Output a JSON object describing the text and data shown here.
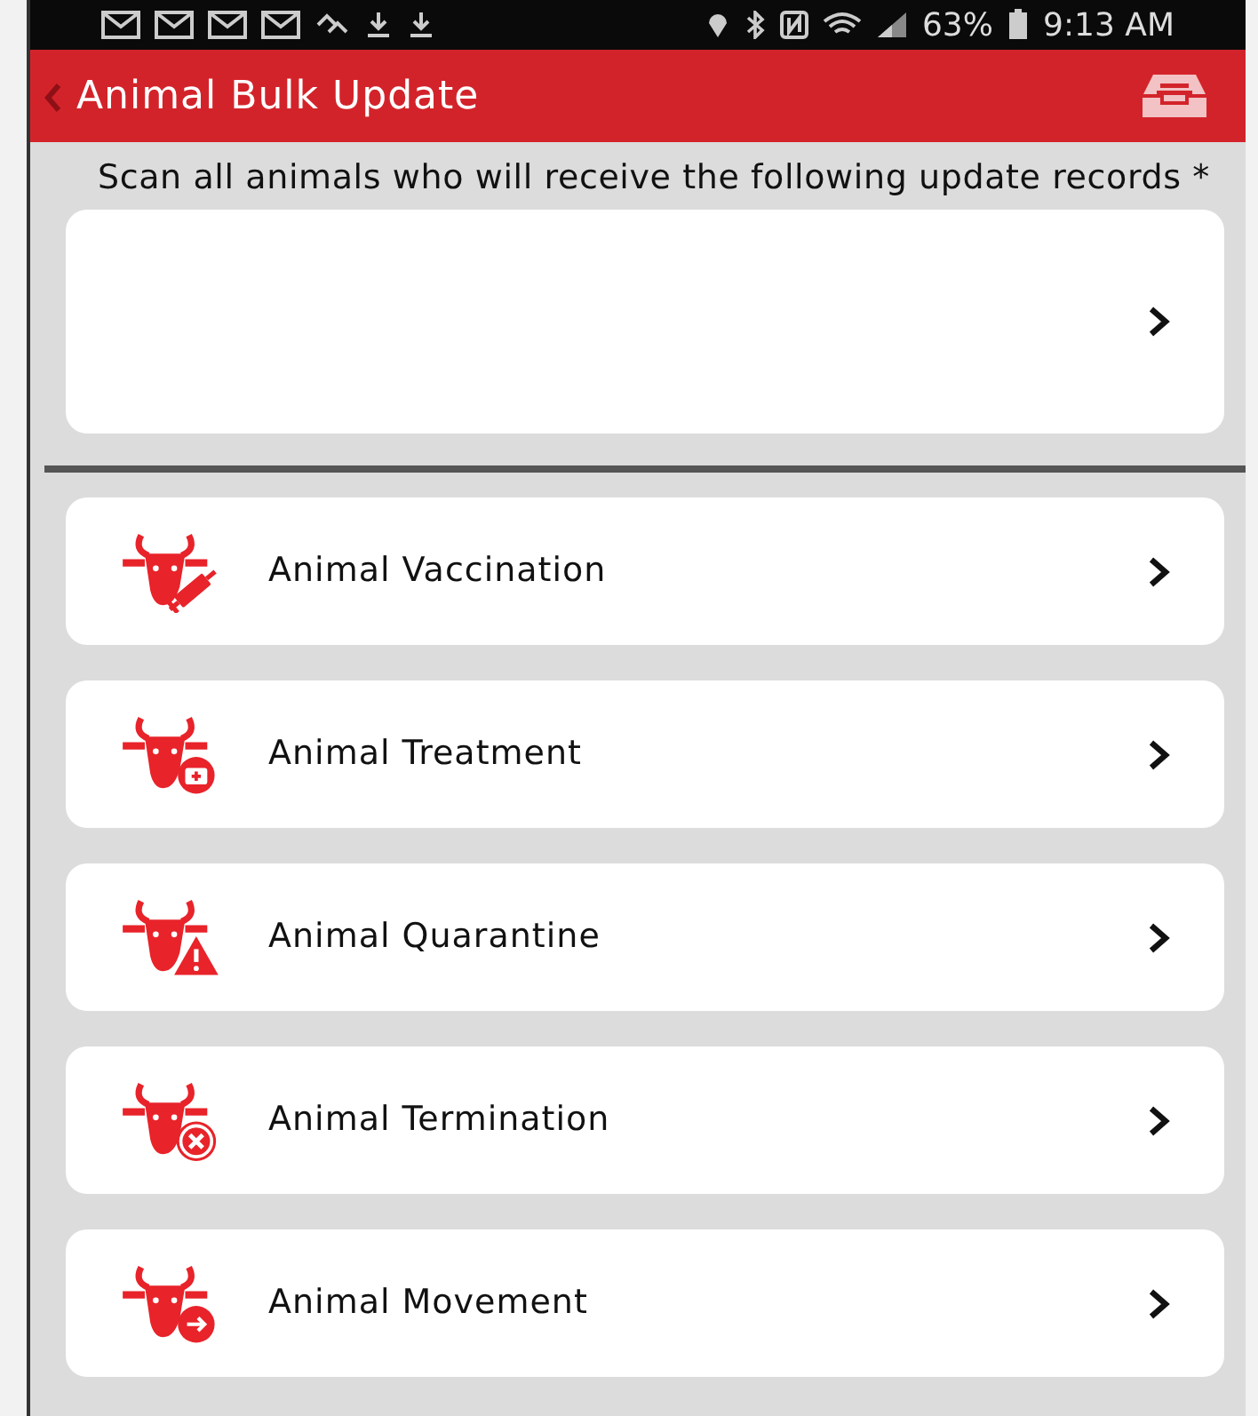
{
  "status_bar": {
    "battery": "63%",
    "time": "9:13 AM"
  },
  "header": {
    "title": "Animal Bulk Update"
  },
  "scan": {
    "label": "Scan all animals who will receive the following update records *"
  },
  "records": [
    {
      "kind": "vaccination",
      "label": "Animal Vaccination"
    },
    {
      "kind": "treatment",
      "label": "Animal Treatment"
    },
    {
      "kind": "quarantine",
      "label": "Animal Quarantine"
    },
    {
      "kind": "termination",
      "label": "Animal Termination"
    },
    {
      "kind": "movement",
      "label": "Animal Movement"
    }
  ]
}
